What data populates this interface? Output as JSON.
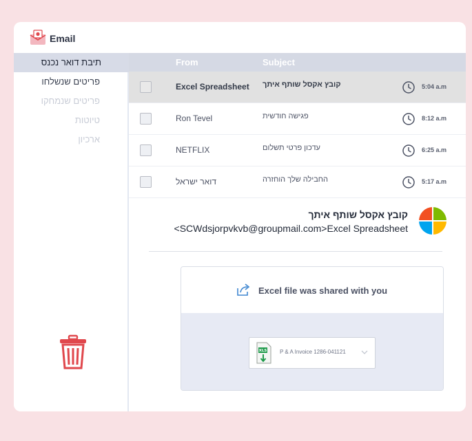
{
  "app": {
    "title": "Email"
  },
  "sidebar": {
    "items": [
      {
        "label": "תיבת דואר נכנס"
      },
      {
        "label": "פריטים שנשלחו"
      },
      {
        "label": "פריטים שנמחקו"
      },
      {
        "label": "טיוטות"
      },
      {
        "label": "ארכיון"
      }
    ]
  },
  "list": {
    "headers": {
      "from": "From",
      "subject": "Subject"
    },
    "rows": [
      {
        "from": "Excel Spreadsheet",
        "subject": "קובץ אקסל שותף איתך",
        "time": "5:04 a.m"
      },
      {
        "from": "Ron Tevel",
        "subject": "פגישה חודשית",
        "time": "8:12 a.m"
      },
      {
        "from": "NETFLIX",
        "subject": "עדכון פרטי תשלום",
        "time": "6:25 a.m"
      },
      {
        "from": "דואר ישראל",
        "subject": "החבילה שלך הוחזרה",
        "time": "5:17 a.m"
      }
    ]
  },
  "preview": {
    "subject": "קובץ אקסל שותף איתך",
    "sender": "<SCWdsjorpvkvb@groupmail.com>Excel Spreadsheet",
    "card_title": "Excel file was shared with you",
    "file_name": "P & A Invoice 1286-041121",
    "file_icon_text": "XLS"
  },
  "colors": {
    "page_bg": "#f9e1e4",
    "header_bg": "#d5d9e4",
    "trash": "#e0474c",
    "excel_green": "#1e9a4a",
    "ms_red": "#f25022",
    "ms_green": "#7fba00",
    "ms_blue": "#00a4ef",
    "ms_yellow": "#ffb900"
  },
  "icons": {
    "logo": "envelope-icon",
    "trash": "trash-icon",
    "clock": "clock-icon",
    "share": "share-icon",
    "file": "excel-file-icon",
    "chevron": "chevron-down-icon",
    "sender": "microsoft-logo-icon"
  }
}
